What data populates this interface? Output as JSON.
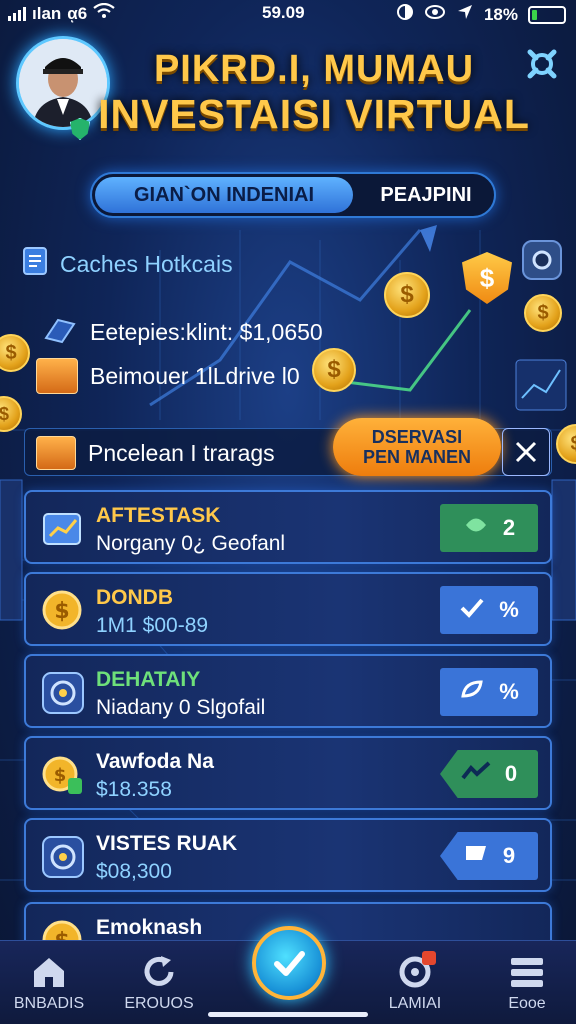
{
  "status_bar": {
    "carrier": "ılan",
    "network": "ᾳ6",
    "time": "59.09",
    "battery": "18%",
    "battery_level": 0.18,
    "icons": [
      "signal-icon",
      "wifi-icon",
      "circle-half-icon",
      "eye-icon",
      "location-arrow-icon",
      "battery-icon"
    ]
  },
  "header": {
    "title_line1": "PIKRD.I, MUMAU",
    "title_line2": "INVESTAISI VIRTUAL",
    "avatar_icon": "user-avatar",
    "settings_icon": "gear-icon"
  },
  "toggle": {
    "option_a": "GIAN`ON INDENIAI",
    "option_b": "PEAJPINI",
    "selected": "option_a"
  },
  "info": {
    "heading": "Caches Hotkcais",
    "line1": "Eetepies:klint: $1,0650",
    "line2": "Beimouer 1lLdrive l0",
    "line3": "Pncelean I trarags"
  },
  "reservasi": {
    "button_line1": "DSERVASI",
    "button_line2": "PEN MANEN",
    "close_icon": "close-icon"
  },
  "cards": [
    {
      "title": "AFTESTASK",
      "subtitle": "Norgany 0¿ Geofanl",
      "action": "2",
      "title_color": "#ffc84a",
      "action_color": "#2f8f5a",
      "icon": "chart-folder-icon",
      "action_icon": "smile-icon"
    },
    {
      "title": "DONDB",
      "subtitle": "1M1 $00-89",
      "action": "%",
      "title_color": "#ffc84a",
      "action_color": "#3a74d8",
      "icon": "coin-icon",
      "action_icon": "check-icon"
    },
    {
      "title": "DEHATAIY",
      "subtitle": "Niadany 0 Slgofail",
      "action": "%",
      "title_color": "#6ee07a",
      "action_color": "#3a74d8",
      "icon": "globe-icon",
      "action_icon": "leaf-icon"
    },
    {
      "title": "Vawfoda Na",
      "subtitle": "$18.358",
      "action": "0",
      "title_color": "#ffffff",
      "action_color": "#2f8f5a",
      "icon": "coin-stack-icon",
      "action_icon": "chart-arrow-icon"
    },
    {
      "title": "VISTES RUAK",
      "subtitle": "$08,300",
      "action": "9",
      "title_color": "#ffffff",
      "action_color": "#3a74d8",
      "icon": "globe-icon",
      "action_icon": "flag-icon"
    },
    {
      "title": "Emoknash",
      "subtitle": "",
      "action": "",
      "title_color": "#ffffff",
      "action_color": "#3a74d8",
      "icon": "coin-icon",
      "action_icon": ""
    }
  ],
  "nav": {
    "items": [
      {
        "label": "BNBADIS",
        "icon": "home-icon"
      },
      {
        "label": "EROUOS",
        "icon": "refresh-icon"
      },
      {
        "label": "",
        "icon": "check-icon"
      },
      {
        "label": "LAMIAI",
        "icon": "location-icon"
      },
      {
        "label": "Eooe",
        "icon": "menu-icon"
      }
    ]
  }
}
